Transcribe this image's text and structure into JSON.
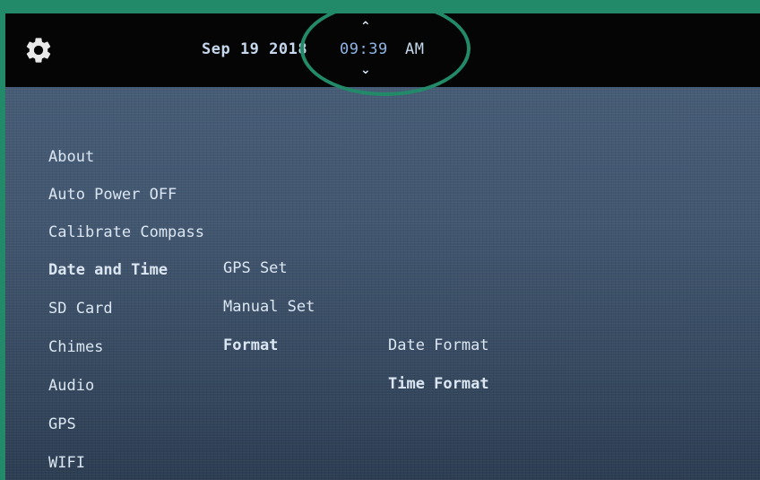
{
  "status_bar": {
    "date": "Sep 19 2018",
    "time": "09:39",
    "ampm": "AM",
    "up_arrow": "⌃",
    "down_arrow": "⌄"
  },
  "icons": {
    "settings": "gear-icon"
  },
  "menu": {
    "items": [
      {
        "label": "About"
      },
      {
        "label": "Auto Power OFF"
      },
      {
        "label": "Calibrate Compass"
      },
      {
        "label": "Date and Time",
        "selected": true
      },
      {
        "label": "SD Card"
      },
      {
        "label": "Chimes"
      },
      {
        "label": "Audio"
      },
      {
        "label": "GPS"
      },
      {
        "label": "WIFI"
      }
    ]
  },
  "date_time_menu": {
    "items": [
      {
        "label": "GPS Set"
      },
      {
        "label": "Manual Set"
      },
      {
        "label": "Format",
        "selected": true
      }
    ]
  },
  "format_menu": {
    "items": [
      {
        "label": "Date Format"
      },
      {
        "label": "Time Format",
        "selected": true
      }
    ]
  },
  "colors": {
    "highlight_ring": "#228a68",
    "time_accent": "#8eb5e8"
  }
}
